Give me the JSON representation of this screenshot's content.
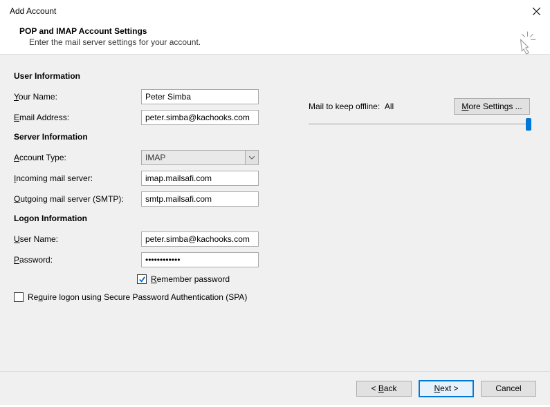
{
  "window": {
    "title": "Add Account"
  },
  "header": {
    "title": "POP and IMAP Account Settings",
    "subtitle": "Enter the mail server settings for your account."
  },
  "sections": {
    "user_info": "User Information",
    "server_info": "Server Information",
    "logon_info": "Logon Information"
  },
  "labels": {
    "your_name_pre": "",
    "your_name_u": "Y",
    "your_name_post": "our Name:",
    "email_u": "E",
    "email_post": "mail Address:",
    "account_type_pre": "",
    "account_type_u": "A",
    "account_type_post": "ccount Type:",
    "incoming_u": "I",
    "incoming_post": "ncoming mail server:",
    "outgoing_u": "O",
    "outgoing_post": "utgoing mail server (SMTP):",
    "username_u": "U",
    "username_post": "ser Name:",
    "password_u": "P",
    "password_post": "assword:",
    "remember_u": "R",
    "remember_post": "emember password",
    "spa_pre": "Re",
    "spa_u": "q",
    "spa_post": "uire logon using Secure Password Authentication (SPA)"
  },
  "values": {
    "your_name": "Peter Simba",
    "email": "peter.simba@kachooks.com",
    "account_type": "IMAP",
    "incoming": "imap.mailsafi.com",
    "outgoing": "smtp.mailsafi.com",
    "username": "peter.simba@kachooks.com",
    "password": "************",
    "remember_checked": true,
    "spa_checked": false
  },
  "offline": {
    "label": "Mail to keep offline:",
    "value": "All"
  },
  "buttons": {
    "more_u": "M",
    "more_post": "ore Settings ...",
    "back_pre": "< ",
    "back_u": "B",
    "back_post": "ack",
    "next_u": "N",
    "next_post": "ext >",
    "cancel": "Cancel"
  }
}
